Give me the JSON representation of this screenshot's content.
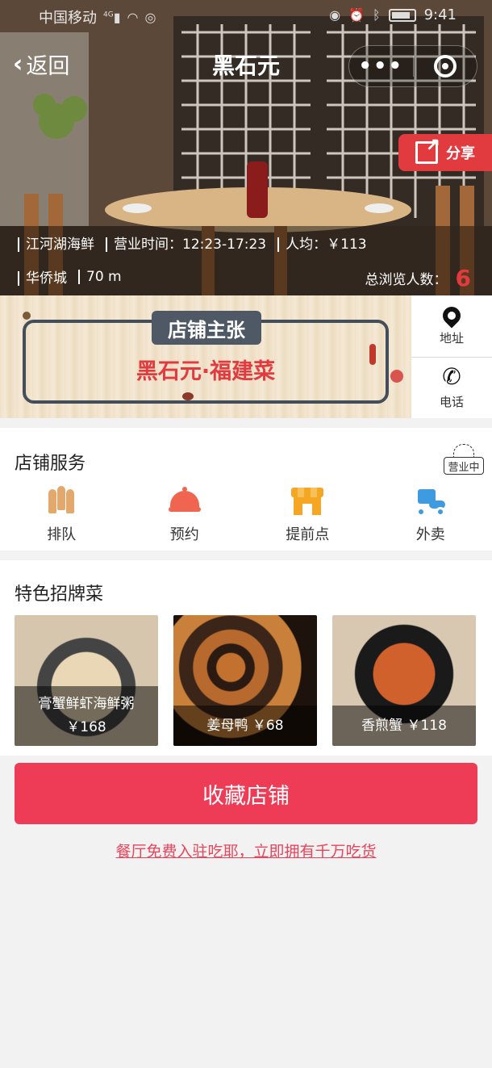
{
  "status_bar": {
    "carrier": "中国移动",
    "network": "4G",
    "time": "9:41"
  },
  "nav": {
    "back_label": "返回",
    "title": "黑石元"
  },
  "share_label": "分享",
  "store_info": {
    "category": "江河湖海鲜",
    "hours": "营业时间：12:23-17:23",
    "avg_price": "人均：￥113",
    "area": "华侨城",
    "distance": "70 m",
    "views_label": "总浏览人数：",
    "views_count": "6"
  },
  "banner": {
    "tag": "店铺主张",
    "text": "黑石元·福建菜"
  },
  "side_actions": {
    "address": "地址",
    "phone": "电话"
  },
  "services": {
    "title": "店铺服务",
    "open_status": "营业中",
    "items": [
      {
        "label": "排队",
        "icon": "queue-icon"
      },
      {
        "label": "预约",
        "icon": "bell-icon"
      },
      {
        "label": "提前点",
        "icon": "shop-icon"
      },
      {
        "label": "外卖",
        "icon": "delivery-icon"
      }
    ]
  },
  "dishes": {
    "title": "特色招牌菜",
    "items": [
      {
        "name": "膏蟹鲜虾海鲜粥",
        "price": "￥168"
      },
      {
        "name": "姜母鸭",
        "price": "￥68"
      },
      {
        "name": "香煎蟹",
        "price": "￥118"
      }
    ]
  },
  "collect_label": "收藏店铺",
  "join_link": "餐厅免费入驻吃耶，立即拥有千万吃货",
  "colors": {
    "accent": "#ee3c57",
    "share": "#e23b3f",
    "banner_tag": "#4f5966"
  }
}
